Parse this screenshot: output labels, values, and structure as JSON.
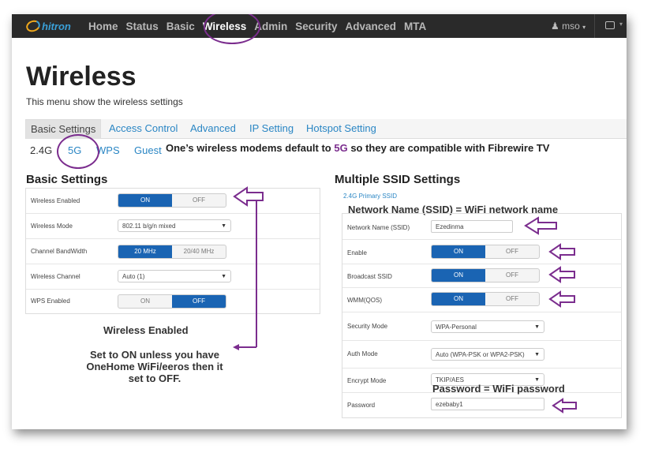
{
  "nav": {
    "logo": "hitron",
    "items": [
      "Home",
      "Status",
      "Basic",
      "Wireless",
      "Admin",
      "Security",
      "Advanced",
      "MTA"
    ],
    "user": "mso"
  },
  "page": {
    "title": "Wireless",
    "subtitle": "This menu show the wireless settings"
  },
  "tabs": [
    "Basic Settings",
    "Access Control",
    "Advanced",
    "IP Setting",
    "Hotspot Setting"
  ],
  "subtabs": [
    "2.4G",
    "5G",
    "WPS",
    "Guest"
  ],
  "annotation_5g": {
    "prefix": "One’s wireless modems default to ",
    "highlight": "5G",
    "suffix": " so they are compatible with Fibrewire TV"
  },
  "basic": {
    "title": "Basic Settings",
    "rows": [
      {
        "label": "Wireless Enabled",
        "on": "ON",
        "off": "OFF",
        "state": "on"
      },
      {
        "label": "Wireless Mode",
        "value": "802.11 b/g/n mixed"
      },
      {
        "label": "Channel BandWidth",
        "on": "20 MHz",
        "off": "20/40 MHz",
        "state": "on"
      },
      {
        "label": "Wireless Channel",
        "value": "Auto (1)"
      },
      {
        "label": "WPS Enabled",
        "on": "ON",
        "off": "OFF",
        "state": "off"
      }
    ]
  },
  "ssid": {
    "title": "Multiple SSID Settings",
    "primary": "2.4G Primary SSID",
    "rows": [
      {
        "label": "Network Name (SSID)",
        "value": "Ezedinma"
      },
      {
        "label": "Enable",
        "on": "ON",
        "off": "OFF",
        "state": "on"
      },
      {
        "label": "Broadcast SSID",
        "on": "ON",
        "off": "OFF",
        "state": "on"
      },
      {
        "label": "WMM(QOS)",
        "on": "ON",
        "off": "OFF",
        "state": "on"
      },
      {
        "label": "Security Mode",
        "value": "WPA-Personal"
      },
      {
        "label": "Auth Mode",
        "value": "Auto (WPA-PSK or WPA2-PSK)"
      },
      {
        "label": "Encrypt Mode",
        "value": "TKIP/AES"
      },
      {
        "label": "Password",
        "value": "ezebaby1"
      }
    ]
  },
  "annotations": {
    "network_name": "Network Name (SSID) = WiFi network name",
    "password": "Password = WiFi password",
    "wireless_enabled_title": "Wireless Enabled",
    "wireless_enabled_note_1": "Set to ON unless you have",
    "wireless_enabled_note_2": "OneHome WiFi/eeros then it",
    "wireless_enabled_note_3": "set to OFF."
  },
  "colors": {
    "accent": "#1a64b3",
    "annotation": "#7b2d8e",
    "link": "#2a86c4",
    "navbar": "#2a2a2a"
  }
}
